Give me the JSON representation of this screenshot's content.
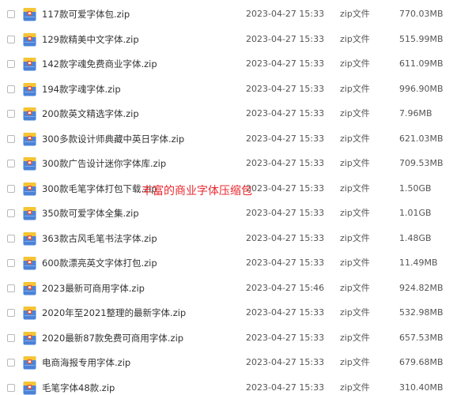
{
  "annotation_text": "丰富的商业字体压缩包",
  "accent_colors": {
    "icon_body": "#4a82d8",
    "icon_top": "#f5c533",
    "icon_clasp": "#e25a3c",
    "annotation": "#e8292f"
  },
  "icon_name": "zip-archive-icon",
  "files": [
    {
      "name": "117款可爱字体包.zip",
      "date": "2023-04-27 15:33",
      "type": "zip文件",
      "size": "770.03MB"
    },
    {
      "name": "129款精美中文字体.zip",
      "date": "2023-04-27 15:33",
      "type": "zip文件",
      "size": "515.99MB"
    },
    {
      "name": "142款字魂免费商业字体.zip",
      "date": "2023-04-27 15:33",
      "type": "zip文件",
      "size": "611.09MB"
    },
    {
      "name": "194款字魂字体.zip",
      "date": "2023-04-27 15:33",
      "type": "zip文件",
      "size": "996.90MB"
    },
    {
      "name": "200款英文精选字体.zip",
      "date": "2023-04-27 15:33",
      "type": "zip文件",
      "size": "7.96MB"
    },
    {
      "name": "300多款设计师典藏中英日字体.zip",
      "date": "2023-04-27 15:33",
      "type": "zip文件",
      "size": "621.03MB"
    },
    {
      "name": "300款广告设计迷你字体库.zip",
      "date": "2023-04-27 15:33",
      "type": "zip文件",
      "size": "709.53MB"
    },
    {
      "name": "300款毛笔字体打包下载.zip",
      "date": "2023-04-27 15:33",
      "type": "zip文件",
      "size": "1.50GB"
    },
    {
      "name": "350款可爱字体全集.zip",
      "date": "2023-04-27 15:33",
      "type": "zip文件",
      "size": "1.01GB"
    },
    {
      "name": "363款古风毛笔书法字体.zip",
      "date": "2023-04-27 15:33",
      "type": "zip文件",
      "size": "1.48GB"
    },
    {
      "name": "600款漂亮英文字体打包.zip",
      "date": "2023-04-27 15:33",
      "type": "zip文件",
      "size": "11.49MB"
    },
    {
      "name": "2023最新可商用字体.zip",
      "date": "2023-04-27 15:46",
      "type": "zip文件",
      "size": "924.82MB"
    },
    {
      "name": "2020年至2021整理的最新字体.zip",
      "date": "2023-04-27 15:33",
      "type": "zip文件",
      "size": "532.98MB"
    },
    {
      "name": "2020最新87款免费可商用字体.zip",
      "date": "2023-04-27 15:33",
      "type": "zip文件",
      "size": "657.53MB"
    },
    {
      "name": "电商海报专用字体.zip",
      "date": "2023-04-27 15:33",
      "type": "zip文件",
      "size": "679.68MB"
    },
    {
      "name": "毛笔字体48款.zip",
      "date": "2023-04-27 15:33",
      "type": "zip文件",
      "size": "310.40MB"
    }
  ]
}
